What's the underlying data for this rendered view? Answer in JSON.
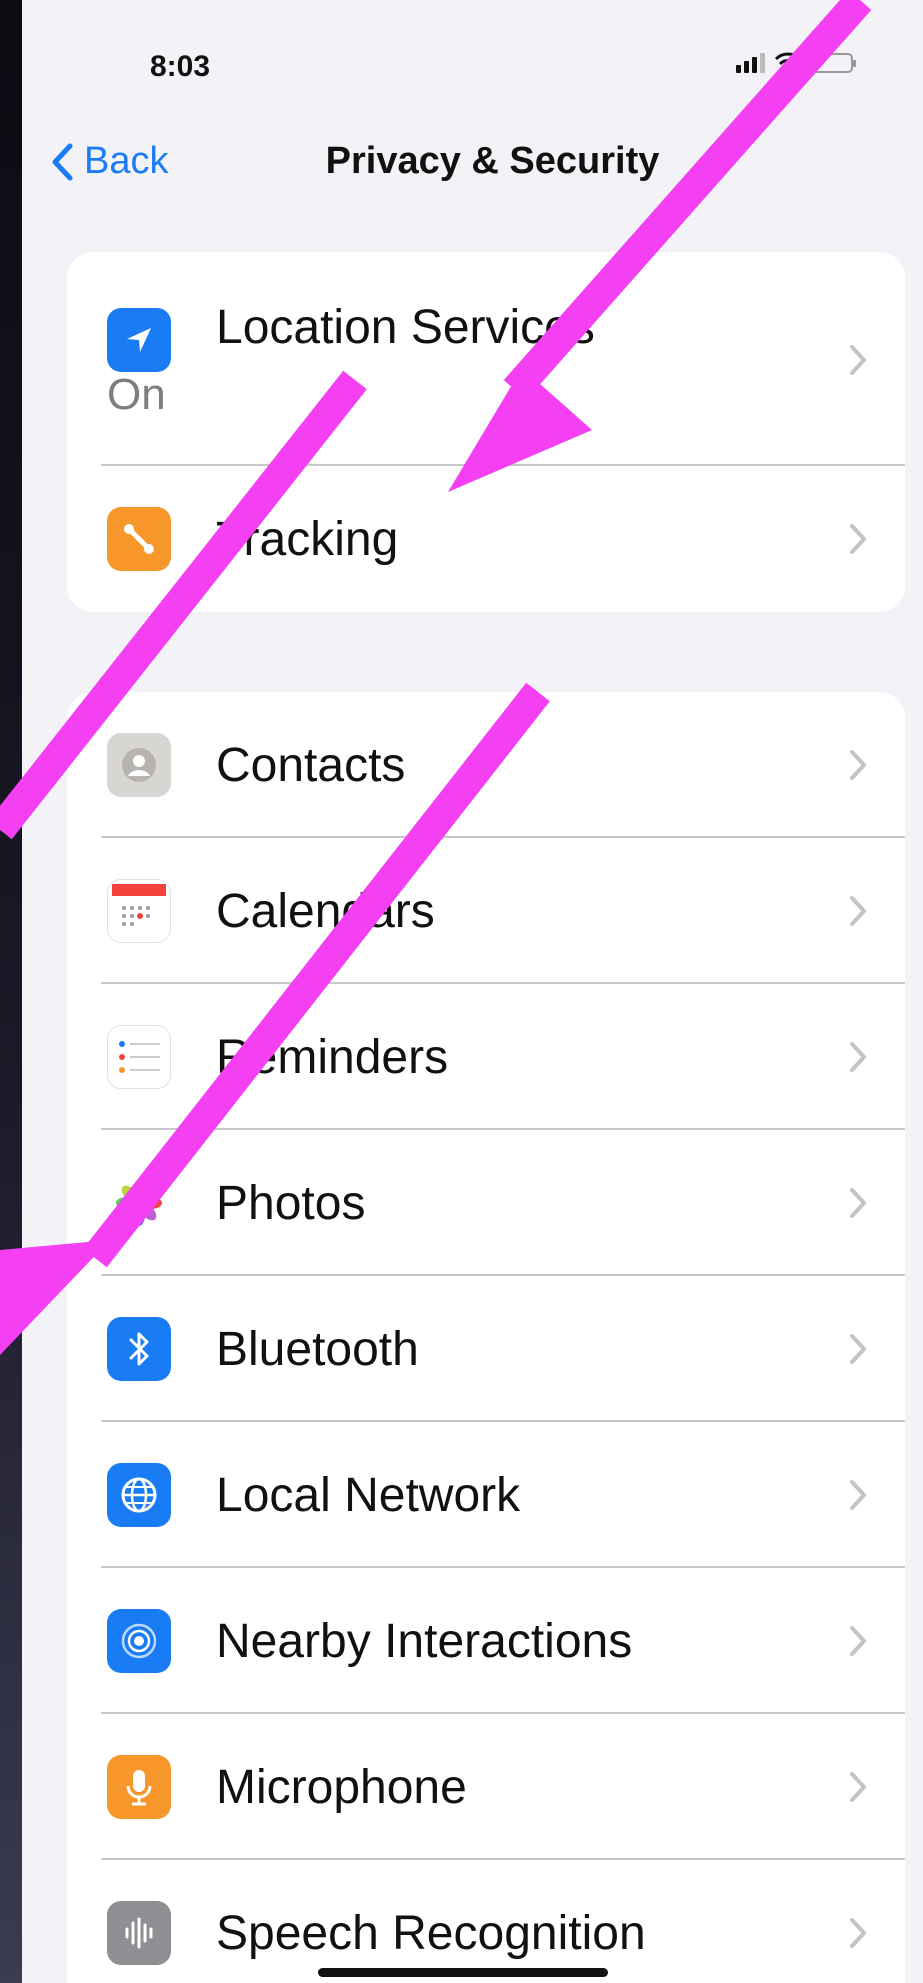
{
  "status_bar": {
    "time": "8:03"
  },
  "nav": {
    "back_label": "Back",
    "title": "Privacy & Security"
  },
  "group_top": [
    {
      "label": "Location Services",
      "value": "On",
      "icon": "location-arrow-icon",
      "icon_color": "#1a7cf5"
    },
    {
      "label": "Tracking",
      "icon": "tracking-icon",
      "icon_color": "#f7962a"
    }
  ],
  "group_perms": [
    {
      "label": "Contacts",
      "icon": "contacts-icon"
    },
    {
      "label": "Calendars",
      "icon": "calendar-icon"
    },
    {
      "label": "Reminders",
      "icon": "reminders-icon"
    },
    {
      "label": "Photos",
      "icon": "photos-icon"
    },
    {
      "label": "Bluetooth",
      "icon": "bluetooth-icon",
      "icon_color": "#1a7cf5"
    },
    {
      "label": "Local Network",
      "icon": "globe-icon",
      "icon_color": "#1a7cf5"
    },
    {
      "label": "Nearby Interactions",
      "icon": "nearby-interactions-icon",
      "icon_color": "#1a7cf5"
    },
    {
      "label": "Microphone",
      "icon": "microphone-icon",
      "icon_color": "#f7962a"
    },
    {
      "label": "Speech Recognition",
      "icon": "speech-recognition-icon",
      "icon_color": "#8e8e93"
    }
  ],
  "annotation": {
    "arrow_color": "#f53ff2"
  }
}
